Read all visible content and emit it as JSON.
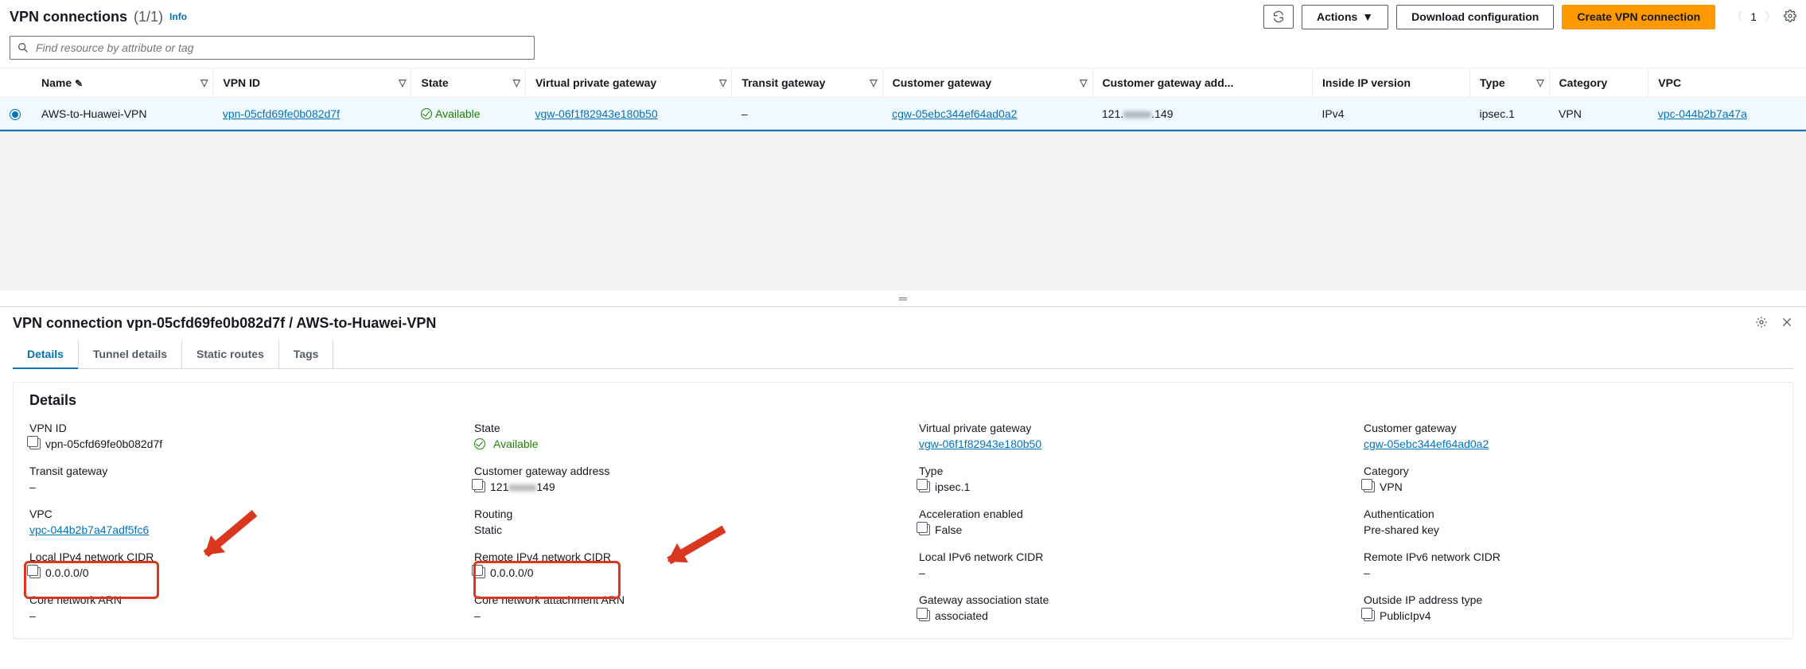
{
  "header": {
    "title": "VPN connections",
    "count": "(1/1)",
    "info": "Info",
    "refresh": "Refresh",
    "actions": "Actions",
    "download": "Download configuration",
    "create": "Create VPN connection",
    "page": "1"
  },
  "search": {
    "placeholder": "Find resource by attribute or tag"
  },
  "columns": {
    "name": "Name",
    "vpnid": "VPN ID",
    "state": "State",
    "vgw": "Virtual private gateway",
    "tgw": "Transit gateway",
    "cgw": "Customer gateway",
    "cgwaddr": "Customer gateway add...",
    "ipver": "Inside IP version",
    "type": "Type",
    "category": "Category",
    "vpc": "VPC"
  },
  "row": {
    "name": "AWS-to-Huawei-VPN",
    "vpnid": "vpn-05cfd69fe0b082d7f",
    "state": "Available",
    "vgw": "vgw-06f1f82943e180b50",
    "tgw": "–",
    "cgw": "cgw-05ebc344ef64ad0a2",
    "cgwaddr_pre": "121.",
    "cgwaddr_blur": "xxxxx",
    "cgwaddr_post": ".149",
    "ipver": "IPv4",
    "type": "ipsec.1",
    "category": "VPN",
    "vpc": "vpc-044b2b7a47a"
  },
  "panelTitle": "VPN connection vpn-05cfd69fe0b082d7f / AWS-to-Huawei-VPN",
  "tabs": {
    "details": "Details",
    "tunnel": "Tunnel details",
    "routes": "Static routes",
    "tags": "Tags"
  },
  "details_heading": "Details",
  "fields": {
    "vpnIdLabel": "VPN ID",
    "vpnId": "vpn-05cfd69fe0b082d7f",
    "stateLabel": "State",
    "state": "Available",
    "vgwLabel": "Virtual private gateway",
    "vgw": "vgw-06f1f82943e180b50",
    "cgwLabel": "Customer gateway",
    "cgw": "cgw-05ebc344ef64ad0a2",
    "tgwLabel": "Transit gateway",
    "tgw": "–",
    "cgwAddrLabel": "Customer gateway address",
    "cgwAddr_pre": "121",
    "cgwAddr_blur": "xxxxx",
    "cgwAddr_post": "149",
    "typeLabel": "Type",
    "type": "ipsec.1",
    "categoryLabel": "Category",
    "category": "VPN",
    "vpcLabel": "VPC",
    "vpc": "vpc-044b2b7a47adf5fc6",
    "routingLabel": "Routing",
    "routing": "Static",
    "accelLabel": "Acceleration enabled",
    "accel": "False",
    "authLabel": "Authentication",
    "auth": "Pre-shared key",
    "lv4Label": "Local IPv4 network CIDR",
    "lv4": "0.0.0.0/0",
    "rv4Label": "Remote IPv4 network CIDR",
    "rv4": "0.0.0.0/0",
    "lv6Label": "Local IPv6 network CIDR",
    "lv6": "–",
    "rv6Label": "Remote IPv6 network CIDR",
    "rv6": "–",
    "coreArnLabel": "Core network ARN",
    "coreArn": "–",
    "coreAttLabel": "Core network attachment ARN",
    "coreAtt": "–",
    "gwAssocLabel": "Gateway association state",
    "gwAssoc": "associated",
    "outIpLabel": "Outside IP address type",
    "outIp": "PublicIpv4"
  }
}
